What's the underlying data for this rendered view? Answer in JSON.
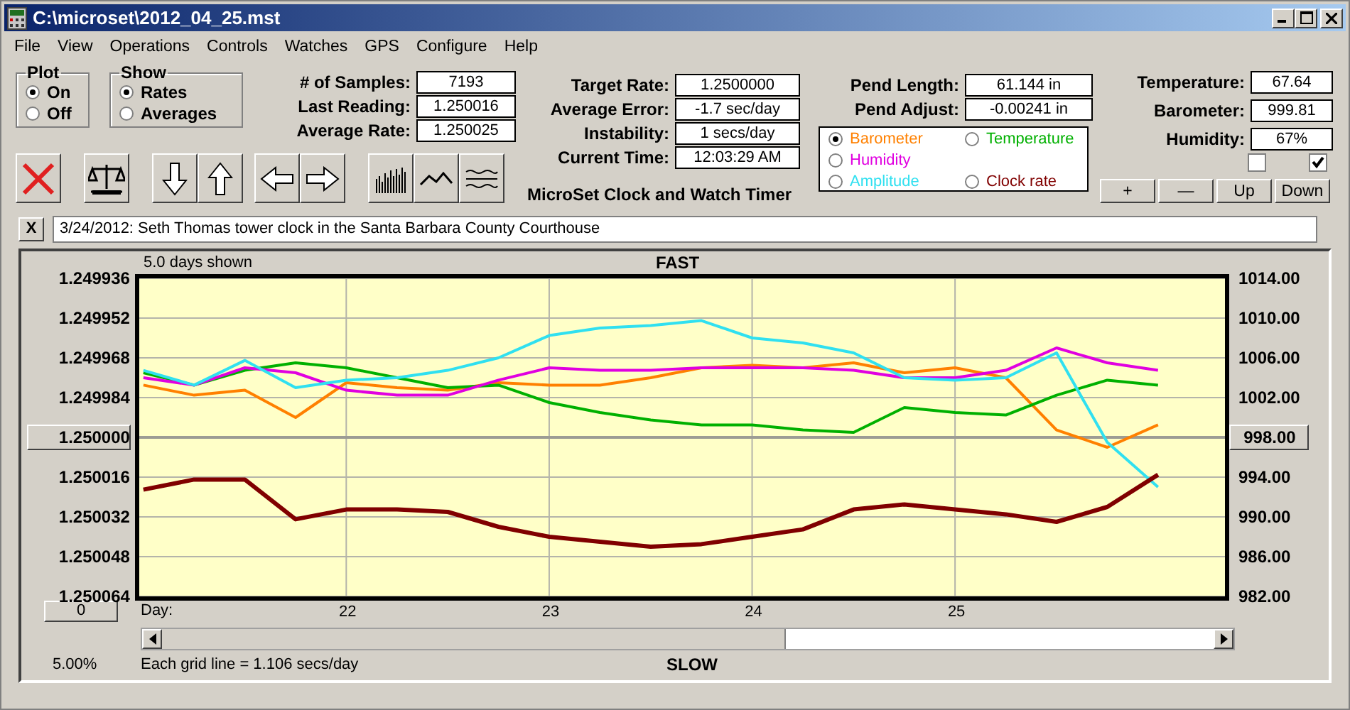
{
  "window": {
    "title": "C:\\microset\\2012_04_25.mst"
  },
  "menu": [
    "File",
    "View",
    "Operations",
    "Controls",
    "Watches",
    "GPS",
    "Configure",
    "Help"
  ],
  "plot_group": {
    "title": "Plot",
    "options": [
      {
        "label": "On",
        "selected": true
      },
      {
        "label": "Off",
        "selected": false
      }
    ]
  },
  "show_group": {
    "title": "Show",
    "options": [
      {
        "label": "Rates",
        "selected": true
      },
      {
        "label": "Averages",
        "selected": false
      }
    ]
  },
  "stats": [
    {
      "label": "# of Samples:",
      "value": "7193"
    },
    {
      "label": "Last Reading:",
      "value": "1.250016"
    },
    {
      "label": "Average Rate:",
      "value": "1.250025"
    }
  ],
  "rates": [
    {
      "label": "Target Rate:",
      "value": "1.2500000"
    },
    {
      "label": "Average Error:",
      "value": "-1.7 sec/day"
    },
    {
      "label": "Instability:",
      "value": "1 secs/day"
    },
    {
      "label": "Current Time:",
      "value": "12:03:29 AM"
    }
  ],
  "app_title": "MicroSet Clock and Watch Timer",
  "pendulum": [
    {
      "label": "Pend Length:",
      "value": "61.144 in"
    },
    {
      "label": "Pend Adjust:",
      "value": "-0.00241 in"
    }
  ],
  "legend": [
    {
      "selected": true
    },
    {
      "selected": false
    },
    {
      "selected": false
    },
    {
      "selected": false
    },
    {
      "selected": false
    }
  ],
  "environment": [
    {
      "label": "Temperature:",
      "value": "67.64"
    },
    {
      "label": "Barometer:",
      "value": "999.81"
    },
    {
      "label": "Humidity:",
      "value": "67%"
    }
  ],
  "checkboxes": [
    {
      "checked": false
    },
    {
      "checked": true
    }
  ],
  "scale_buttons": [
    "+",
    "—",
    "Up",
    "Down"
  ],
  "toolbar": [
    {
      "kind": "clear"
    },
    {
      "kind": "balance"
    },
    {
      "kind": "down"
    },
    {
      "kind": "up"
    },
    {
      "kind": "left"
    },
    {
      "kind": "right"
    },
    {
      "kind": "bars"
    },
    {
      "kind": "wave"
    },
    {
      "kind": "lines"
    }
  ],
  "note": {
    "close": "X",
    "value": "3/24/2012: Seth Thomas tower clock in the Santa Barbara County Courthouse"
  },
  "plot": {
    "days_shown": "5.0 days shown",
    "top_label": "FAST",
    "bottom_label": "SLOW",
    "grid_note": "Each grid line = 1.106 secs/day",
    "zoom": "5.00%",
    "offset_button": "0",
    "right_axis": [
      {
        "label": "1014.00",
        "kind": "tick"
      },
      {
        "label": "1010.00",
        "kind": "tick"
      },
      {
        "label": "1006.00",
        "kind": "tick"
      },
      {
        "label": "1002.00",
        "kind": "tick"
      },
      {
        "label": "998.00",
        "kind": "button"
      },
      {
        "label": "994.00",
        "kind": "tick"
      },
      {
        "label": "990.00",
        "kind": "tick"
      },
      {
        "label": "986.00",
        "kind": "tick"
      },
      {
        "label": "982.00",
        "kind": "tick"
      }
    ],
    "chart_data": {
      "type": "line",
      "xlabel": "Day:",
      "x": [
        21,
        21.25,
        21.5,
        21.75,
        22,
        22.25,
        22.5,
        22.75,
        23,
        23.25,
        23.5,
        23.75,
        24,
        24.25,
        24.5,
        24.75,
        25,
        25.25,
        25.5,
        25.75,
        26
      ],
      "xlim": [
        20.98,
        26.33
      ],
      "ylim": [
        1.250064,
        1.249936
      ],
      "grid": true,
      "ref_lines": [
        {
          "axis": "y",
          "value": 1.25
        }
      ],
      "xticks": [
        {
          "value": 22,
          "label": "22"
        },
        {
          "value": 23,
          "label": "23"
        },
        {
          "value": 24,
          "label": "24"
        },
        {
          "value": 25,
          "label": "25"
        }
      ],
      "yticks": [
        {
          "value": 1.249936,
          "label": "1.249936"
        },
        {
          "value": 1.249952,
          "label": "1.249952"
        },
        {
          "value": 1.249968,
          "label": "1.249968"
        },
        {
          "value": 1.249984,
          "label": "1.249984"
        },
        {
          "value": 1.25,
          "label": "1.250000"
        },
        {
          "value": 1.250016,
          "label": "1.250016"
        },
        {
          "value": 1.250032,
          "label": "1.250032"
        },
        {
          "value": 1.250048,
          "label": "1.250048"
        },
        {
          "value": 1.250064,
          "label": "1.250064"
        }
      ],
      "series": [
        {
          "name": "Barometer",
          "color": "#ff8000",
          "values": [
            1.249979,
            1.249983,
            1.249981,
            1.249992,
            1.249978,
            1.24998,
            1.249981,
            1.249978,
            1.249979,
            1.249979,
            1.249976,
            1.249972,
            1.249971,
            1.249972,
            1.24997,
            1.249974,
            1.249972,
            1.249976,
            1.249997,
            1.250004,
            1.249995
          ]
        },
        {
          "name": "Temperature",
          "color": "#00b000",
          "values": [
            1.249974,
            1.249979,
            1.249973,
            1.24997,
            1.249972,
            1.249976,
            1.24998,
            1.249979,
            1.249986,
            1.24999,
            1.249993,
            1.249995,
            1.249995,
            1.249997,
            1.249998,
            1.249988,
            1.24999,
            1.249991,
            1.249983,
            1.249977,
            1.249979
          ]
        },
        {
          "name": "Humidity",
          "color": "#e000e0",
          "values": [
            1.249976,
            1.249979,
            1.249972,
            1.249974,
            1.249981,
            1.249983,
            1.249983,
            1.249977,
            1.249972,
            1.249973,
            1.249973,
            1.249972,
            1.249972,
            1.249972,
            1.249973,
            1.249976,
            1.249976,
            1.249973,
            1.249964,
            1.24997,
            1.249973
          ]
        },
        {
          "name": "Amplitude",
          "color": "#30e0f0",
          "values": [
            1.249973,
            1.249979,
            1.249969,
            1.24998,
            1.249977,
            1.249976,
            1.249973,
            1.249968,
            1.249959,
            1.249956,
            1.249955,
            1.249953,
            1.24996,
            1.249962,
            1.249966,
            1.249976,
            1.249977,
            1.249976,
            1.249966,
            1.250002,
            1.25002
          ]
        },
        {
          "name": "Clock rate",
          "color": "#800000",
          "values": [
            1.250021,
            1.250017,
            1.250017,
            1.250033,
            1.250029,
            1.250029,
            1.25003,
            1.250036,
            1.25004,
            1.250042,
            1.250044,
            1.250043,
            1.25004,
            1.250037,
            1.250029,
            1.250027,
            1.250029,
            1.250031,
            1.250034,
            1.250028,
            1.250015
          ]
        }
      ]
    }
  }
}
